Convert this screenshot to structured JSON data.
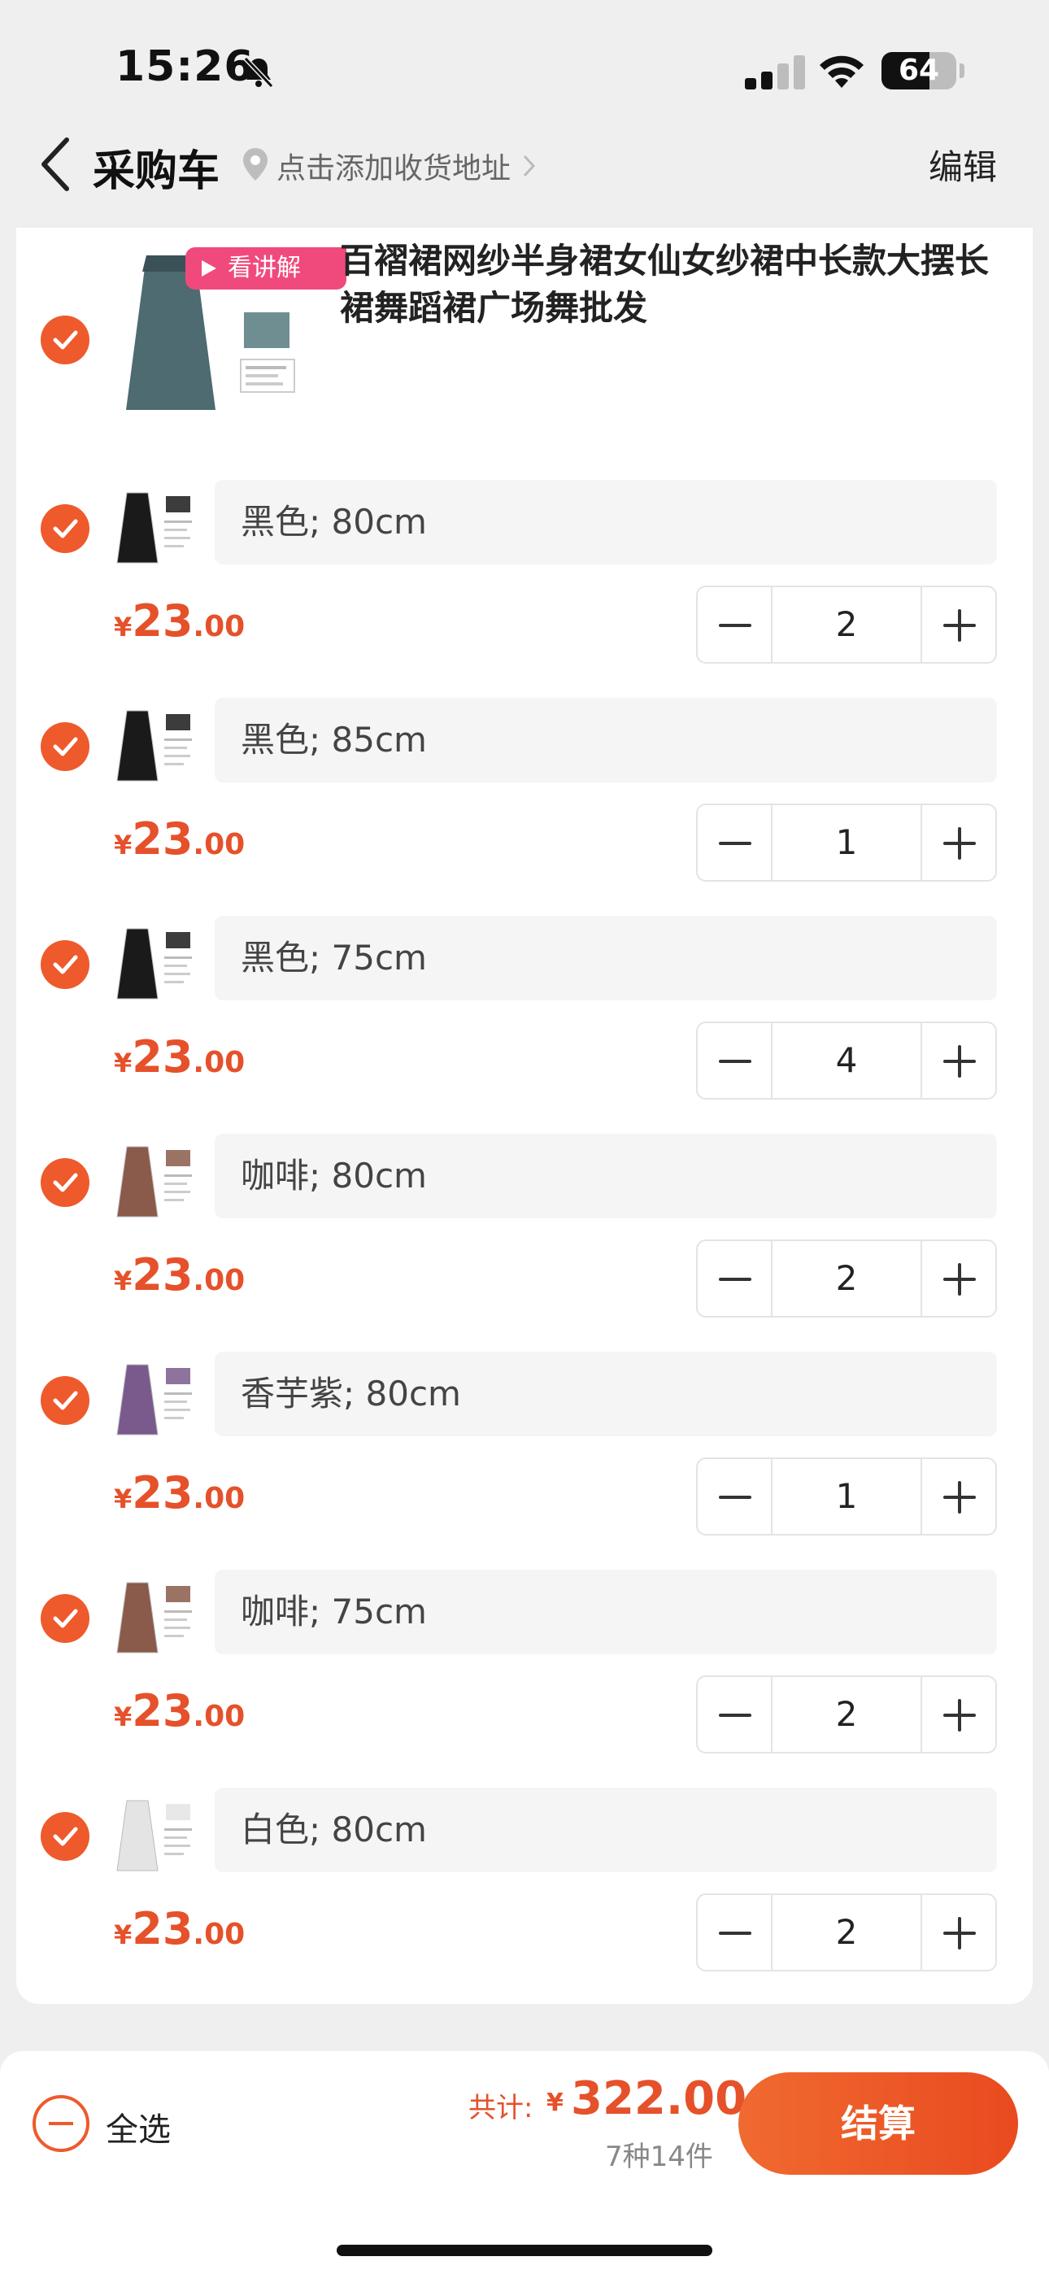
{
  "status_bar": {
    "time": "15:26",
    "battery": "64",
    "battery_fraction": 0.64
  },
  "nav": {
    "title": "采购车",
    "address_hint": "点击添加收货地址",
    "edit_label": "编辑"
  },
  "product": {
    "title": "百褶裙网纱半身裙女仙女纱裙中长款大摆长裙舞蹈裙广场舞批发",
    "badge": "看讲解"
  },
  "variants": [
    {
      "spec": "黑色; 80cm",
      "currency": "¥",
      "price_int": "23",
      "price_dec": ".00",
      "qty": "2",
      "color": "#1a1a1a"
    },
    {
      "spec": "黑色; 85cm",
      "currency": "¥",
      "price_int": "23",
      "price_dec": ".00",
      "qty": "1",
      "color": "#1a1a1a"
    },
    {
      "spec": "黑色; 75cm",
      "currency": "¥",
      "price_int": "23",
      "price_dec": ".00",
      "qty": "4",
      "color": "#1a1a1a"
    },
    {
      "spec": "咖啡; 80cm",
      "currency": "¥",
      "price_int": "23",
      "price_dec": ".00",
      "qty": "2",
      "color": "#8a5a4a"
    },
    {
      "spec": "香芋紫; 80cm",
      "currency": "¥",
      "price_int": "23",
      "price_dec": ".00",
      "qty": "1",
      "color": "#7a5a8c"
    },
    {
      "spec": "咖啡; 75cm",
      "currency": "¥",
      "price_int": "23",
      "price_dec": ".00",
      "qty": "2",
      "color": "#8a5a4a"
    },
    {
      "spec": "白色; 80cm",
      "currency": "¥",
      "price_int": "23",
      "price_dec": ".00",
      "qty": "2",
      "color": "#e4e4e4"
    }
  ],
  "bottom": {
    "select_all": "全选",
    "total_label": "共计:",
    "total_currency": "¥",
    "total_value": "322.00",
    "count": "7种14件",
    "checkout": "结算"
  },
  "colors": {
    "accent": "#ee5a2c",
    "price": "#e5512a",
    "badge": "#f04a7d"
  }
}
